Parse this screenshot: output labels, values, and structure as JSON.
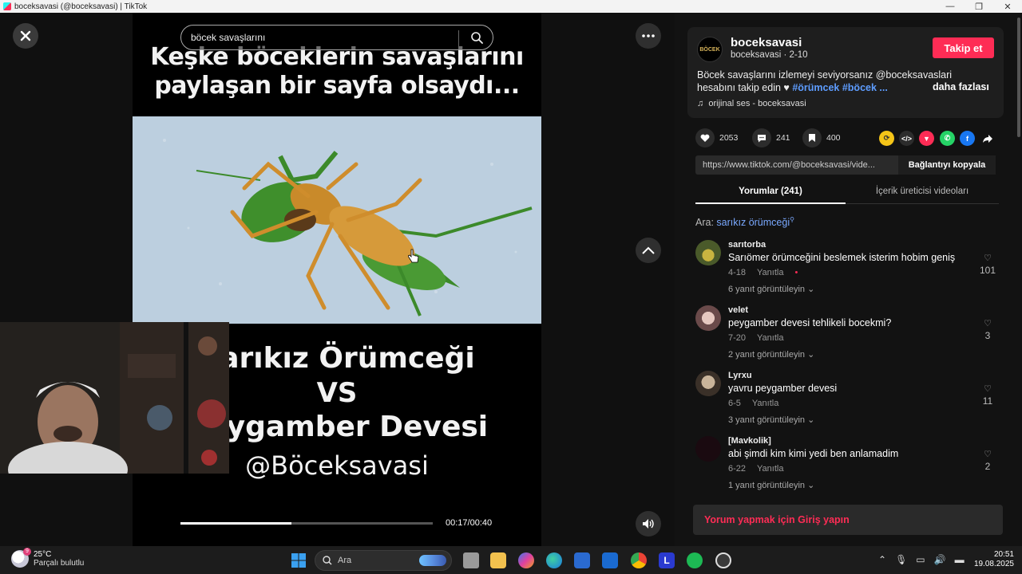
{
  "window": {
    "title": "boceksavasi (@boceksavasi) | TikTok",
    "controls": [
      "—",
      "❐",
      "✕"
    ]
  },
  "player": {
    "search_value": "böcek savaşlarını",
    "headline_line1": "Keşke böceklerin savaşlarını",
    "headline_line2": "paylaşan bir sayfa olsaydı...",
    "title_line1": "Sarıkız Örümceği",
    "title_line2": "VS",
    "title_line3": "Peygamber Devesi",
    "title_line4": "@Böceksavasi",
    "time": "00:17/00:40",
    "progress": 0.44
  },
  "author": {
    "username": "boceksavasi",
    "subline": "boceksavasi · 2-10",
    "avatar_text": "BÖCEK",
    "follow_label": "Takip et"
  },
  "description": {
    "text": "Böcek savaşlarını izlemeyi seviyorsanız @boceksavaslari hesabını takip edin ♥ ",
    "tags": "#örümcek #böcek ...",
    "more_label": "daha fazlası",
    "sound": "orijinal ses - boceksavasi"
  },
  "stats": {
    "likes": "2053",
    "comments": "241",
    "saves": "400"
  },
  "link": {
    "url": "https://www.tiktok.com/@boceksavasi/vide...",
    "copy_label": "Bağlantıyı kopyala"
  },
  "tabs": {
    "comments": "Yorumlar (241)",
    "creator_videos": "İçerik üreticisi videoları"
  },
  "search_hint": {
    "label": "Ara: ",
    "keyword": "sarıkız örümceği"
  },
  "comments": [
    {
      "user": "sarıtorba",
      "text": "Sarıömer örümceğini beslemek isterim hobim geniş",
      "date": "4-18",
      "reply": "Yanıtla",
      "replies": "6 yanıt görüntüleyin",
      "likes": "101",
      "color": "#6a6a2a"
    },
    {
      "user": "velet",
      "text": "peygamber devesi tehlikeli bocekmi?",
      "date": "7-20",
      "reply": "Yanıtla",
      "replies": "2 yanıt görüntüleyin",
      "likes": "3",
      "color": "#b08a8a"
    },
    {
      "user": "Lyrxu",
      "text": "yavru peygamber devesi",
      "date": "6-5",
      "reply": "Yanıtla",
      "replies": "3 yanıt görüntüleyin",
      "likes": "11",
      "color": "#9a8a70"
    },
    {
      "user": "[Mavkolik]",
      "text": "abi şimdi kim kimi yedi ben anlamadim",
      "date": "6-22",
      "reply": "Yanıtla",
      "replies": "1 yanıt görüntüleyin",
      "likes": "2",
      "color": "#1a0a10"
    }
  ],
  "login_prompt": "Yorum yapmak için Giriş yapın",
  "taskbar": {
    "temp": "25°C",
    "weather": "Parçalı bulutlu",
    "weather_badge": "9",
    "search_label": "Ara",
    "time": "20:51",
    "date": "19.08.2025"
  },
  "colors": {
    "accent": "#fe2c55",
    "hashtag": "#5e9dff"
  }
}
